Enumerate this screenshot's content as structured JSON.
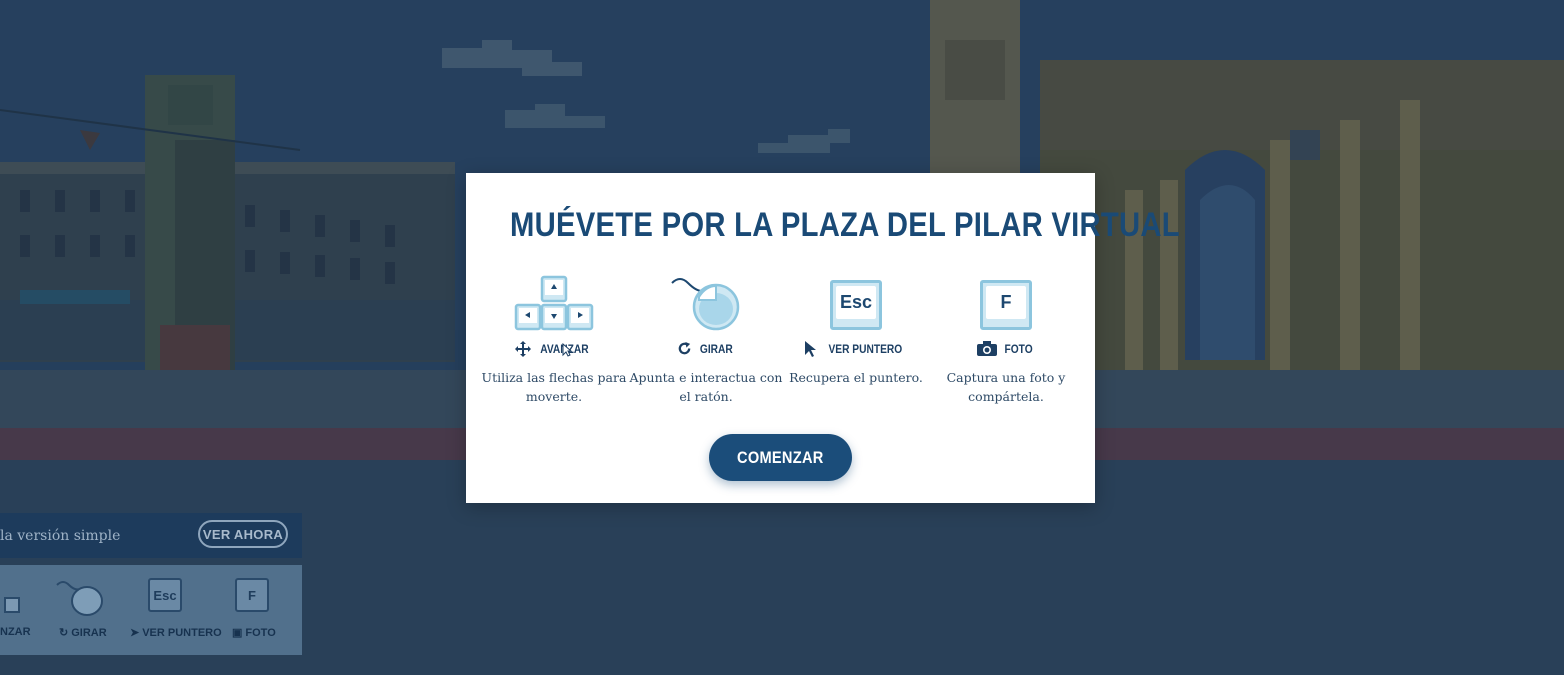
{
  "modal": {
    "title": "MUÉVETE POR LA PLAZA DEL PILAR VIRTUAL",
    "controls": [
      {
        "icon": "arrow-keys-icon",
        "label_icon": "move-icon",
        "label": "AVANZAR",
        "description": "Utiliza las flechas para moverte."
      },
      {
        "icon": "mouse-icon",
        "label_icon": "rotate-icon",
        "label": "GIRAR",
        "description": "Apunta e interactua con el ratón."
      },
      {
        "icon": "esc-key-icon",
        "key": "Esc",
        "label_icon": "pointer-icon",
        "label": "VER PUNTERO",
        "description": "Recupera el puntero."
      },
      {
        "icon": "f-key-icon",
        "key": "F",
        "label_icon": "camera-icon",
        "label": "FOTO",
        "description": "Captura una foto y compártela."
      }
    ],
    "start_button": "COMENZAR"
  },
  "side_panel": {
    "simple_text": "la versión simple",
    "view_button": "VER AHORA",
    "mini_controls": [
      {
        "label": "NZAR"
      },
      {
        "label": "GIRAR"
      },
      {
        "key": "Esc",
        "label": "VER PUNTERO"
      },
      {
        "key": "F",
        "label": "FOTO"
      }
    ]
  },
  "colors": {
    "accent": "#1b4d7a",
    "title": "#1a4a76",
    "key_border": "#8cc5de",
    "overlay": "#26415b"
  }
}
